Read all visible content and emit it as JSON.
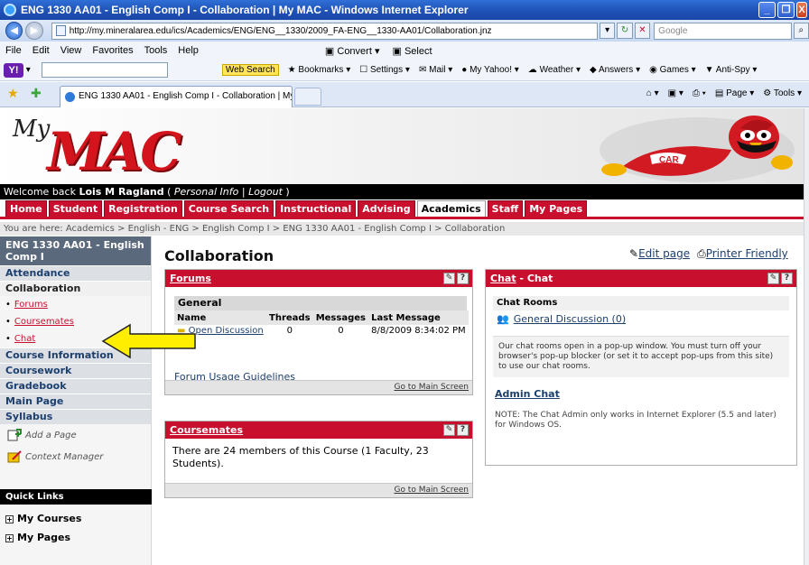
{
  "window": {
    "title": "ENG 1330 AA01 - English Comp I - Collaboration | My MAC - Windows Internet Explorer",
    "controls": [
      "_",
      "❐",
      "X"
    ]
  },
  "address": {
    "url": "http://my.mineralarea.edu/ics/Academics/ENG/ENG__1330/2009_FA-ENG__1330-AA01/Collaboration.jnz",
    "search_placeholder": "Google"
  },
  "menu": {
    "items": [
      "File",
      "Edit",
      "View",
      "Favorites",
      "Tools",
      "Help"
    ],
    "convert": "Convert",
    "select": "Select"
  },
  "toolbar2": {
    "yahoo": "Y!",
    "web_search": "Web Search",
    "bookmarks": "Bookmarks",
    "settings": "Settings",
    "mail": "Mail",
    "my_yahoo": "My Yahoo!",
    "weather": "Weather",
    "answers": "Answers",
    "games": "Games",
    "antispy": "Anti-Spy"
  },
  "browser_tab": {
    "title": "ENG 1330 AA01 - English Comp I - Collaboration | My ...",
    "page_menu": "Page",
    "tools_menu": "Tools"
  },
  "banner": {
    "logo_my": "My",
    "logo_mac": "MAC"
  },
  "welcome": {
    "prefix": "Welcome back ",
    "user": "Lois M Ragland",
    "open": " ( ",
    "personal_info": "Personal Info",
    "sep": " | ",
    "logout": "Logout",
    "close": " )"
  },
  "nav_tabs": [
    "Home",
    "Student",
    "Registration",
    "Course Search",
    "Instructional",
    "Advising",
    "Academics",
    "Staff",
    "My Pages"
  ],
  "nav_active_index": 6,
  "breadcrumb": "You are here: Academics > English - ENG > English Comp I > ENG 1330 AA01 - English Comp I > Collaboration",
  "sidebar": {
    "course_title": "ENG 1330 AA01 - English Comp I",
    "attendance": "Attendance",
    "collaboration": "Collaboration",
    "sub_links": [
      "Forums",
      "Coursemates",
      "Chat"
    ],
    "course_information": "Course Information",
    "coursework": "Coursework",
    "gradebook": "Gradebook",
    "main_page": "Main Page",
    "syllabus": "Syllabus",
    "add_page": "Add a Page",
    "context_manager": "Context Manager",
    "quick_links": "Quick Links",
    "my_courses": "My Courses",
    "my_pages": "My Pages"
  },
  "main": {
    "title": "Collaboration",
    "edit_page": "Edit page",
    "printer_friendly": "Printer Friendly"
  },
  "forums": {
    "title": "Forums",
    "group": "General",
    "columns": [
      "Name",
      "Threads",
      "Messages",
      "Last Message"
    ],
    "rows": [
      {
        "name": "Open Discussion",
        "threads": "0",
        "messages": "0",
        "last_message": "8/8/2009 8:34:02 PM"
      }
    ],
    "guidelines": "Forum Usage Guidelines",
    "footer": "Go to Main Screen"
  },
  "coursemates": {
    "title": "Coursemates",
    "text": "There are 24 members of this Course (1 Faculty, 23 Students).",
    "footer": "Go to Main Screen"
  },
  "chat": {
    "title_link": "Chat",
    "title_suffix": " - Chat",
    "rooms_header": "Chat Rooms",
    "room": "General Discussion (0)",
    "popup_note": "Our chat rooms open in a pop-up window. You must turn off your browser's pop-up blocker (or set it to accept pop-ups from this site) to use our chat rooms.",
    "admin_chat": "Admin Chat",
    "admin_note": "NOTE: The Chat Admin only works in Internet Explorer (5.5 and later) for Windows OS."
  },
  "colors": {
    "brand_red": "#c8102e",
    "link_blue": "#1c3f6e",
    "arrow_yellow": "#ffee00"
  }
}
